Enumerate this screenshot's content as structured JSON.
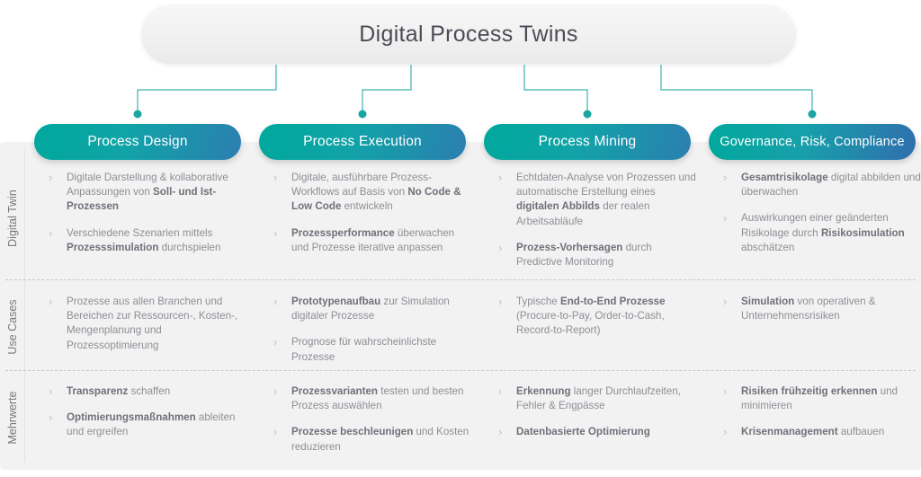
{
  "title": {
    "text": "Digital Process Twins"
  },
  "colors": {
    "accent_teal": "#00a89c",
    "accent_blue": "#2b7fb0",
    "connector": "#1aa5a0",
    "panel_bg": "#f2f2f2",
    "text": "#8e8e96",
    "text_bold": "#70707a",
    "chevron": "#c2c2c8",
    "divider": "#c9c9c9"
  },
  "row_labels": [
    {
      "label": "Digital Twin"
    },
    {
      "label": "Use Cases"
    },
    {
      "label": "Mehrwerte"
    }
  ],
  "columns": [
    {
      "header": "Process Design",
      "rows": [
        {
          "bullets": [
            [
              {
                "t": "Digitale Darstellung & kollaborative Anpassungen von ",
                "b": false
              },
              {
                "t": "Soll- und Ist-Prozessen",
                "b": true
              }
            ],
            [
              {
                "t": "Verschiedene Szenarien mittels ",
                "b": false
              },
              {
                "t": "Prozesssimulation",
                "b": true
              },
              {
                "t": " durchspielen",
                "b": false
              }
            ]
          ]
        },
        {
          "bullets": [
            [
              {
                "t": "Prozesse aus allen Branchen und Bereichen zur Ressourcen-, Kosten-, Mengenplanung und Prozessoptimierung",
                "b": false
              }
            ]
          ]
        },
        {
          "bullets": [
            [
              {
                "t": "Transparenz",
                "b": true
              },
              {
                "t": " schaffen",
                "b": false
              }
            ],
            [
              {
                "t": "Optimierungsmaßnahmen",
                "b": true
              },
              {
                "t": " ableiten und ergreifen",
                "b": false
              }
            ]
          ]
        }
      ]
    },
    {
      "header": "Process Execution",
      "rows": [
        {
          "bullets": [
            [
              {
                "t": "Digitale, ausführbare Prozess-Workflows auf Basis von ",
                "b": false
              },
              {
                "t": "No Code & Low Code",
                "b": true
              },
              {
                "t": " entwickeln",
                "b": false
              }
            ],
            [
              {
                "t": "Prozessperformance",
                "b": true
              },
              {
                "t": " überwachen und Prozesse iterative anpassen",
                "b": false
              }
            ]
          ]
        },
        {
          "bullets": [
            [
              {
                "t": "Prototypenaufbau",
                "b": true
              },
              {
                "t": " zur Simulation digitaler Prozesse",
                "b": false
              }
            ],
            [
              {
                "t": "Prognose für wahrscheinlichste Prozesse",
                "b": false
              }
            ]
          ]
        },
        {
          "bullets": [
            [
              {
                "t": "Prozessvarianten",
                "b": true
              },
              {
                "t": " testen und besten Prozess auswählen",
                "b": false
              }
            ],
            [
              {
                "t": "Prozesse beschleunigen",
                "b": true
              },
              {
                "t": " und Kosten reduzieren",
                "b": false
              }
            ]
          ]
        }
      ]
    },
    {
      "header": "Process Mining",
      "rows": [
        {
          "bullets": [
            [
              {
                "t": "Echtdaten-Analyse von Prozessen und automatische Erstellung eines ",
                "b": false
              },
              {
                "t": "digitalen Abbilds",
                "b": true
              },
              {
                "t": " der realen Arbeitsabläufe",
                "b": false
              }
            ],
            [
              {
                "t": "Prozess-Vorhersagen",
                "b": true
              },
              {
                "t": " durch Predictive Monitoring",
                "b": false
              }
            ]
          ]
        },
        {
          "bullets": [
            [
              {
                "t": "Typische ",
                "b": false
              },
              {
                "t": "End-to-End Prozesse",
                "b": true
              },
              {
                "t": " (Procure-to-Pay, Order-to-Cash, Record-to-Report)",
                "b": false
              }
            ]
          ]
        },
        {
          "bullets": [
            [
              {
                "t": "Erkennung",
                "b": true
              },
              {
                "t": " langer Durchlaufzeiten, Fehler & Engpässe",
                "b": false
              }
            ],
            [
              {
                "t": "Datenbasierte Optimierung",
                "b": true
              }
            ]
          ]
        }
      ]
    },
    {
      "header": "Governance, Risk, Compliance",
      "rows": [
        {
          "bullets": [
            [
              {
                "t": "Gesamtrisikolage",
                "b": true
              },
              {
                "t": " digital abbilden und überwachen",
                "b": false
              }
            ],
            [
              {
                "t": "Auswirkungen einer geänderten Risikolage durch ",
                "b": false
              },
              {
                "t": "Risikosimulation",
                "b": true
              },
              {
                "t": " abschätzen",
                "b": false
              }
            ]
          ]
        },
        {
          "bullets": [
            [
              {
                "t": "Simulation",
                "b": true
              },
              {
                "t": " von operativen & Unternehmensrisiken",
                "b": false
              }
            ]
          ]
        },
        {
          "bullets": [
            [
              {
                "t": "Risiken frühzeitig erkennen",
                "b": true
              },
              {
                "t": " und minimieren",
                "b": false
              }
            ],
            [
              {
                "t": "Krisenmanagement",
                "b": true
              },
              {
                "t": " aufbauen",
                "b": false
              }
            ]
          ]
        }
      ]
    }
  ],
  "icons": {
    "bullet_chevron": "chevron-right-icon"
  }
}
